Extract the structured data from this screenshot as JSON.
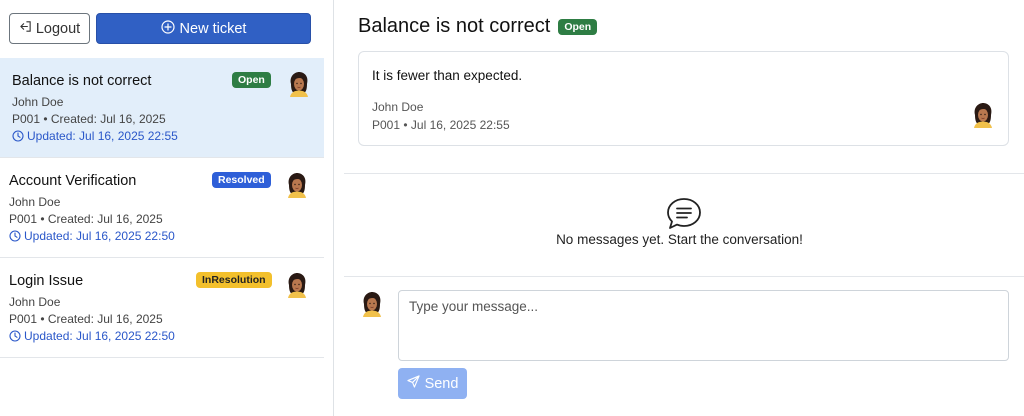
{
  "sidebar": {
    "logout_label": "Logout",
    "new_ticket_label": "New ticket",
    "tickets": [
      {
        "title": "Balance is not correct",
        "status": "Open",
        "name": "John Doe",
        "meta": "P001 • Created: Jul 16, 2025",
        "updated": "Updated: Jul 16, 2025 22:55"
      },
      {
        "title": "Account Verification",
        "status": "Resolved",
        "name": "John Doe",
        "meta": "P001 • Created: Jul 16, 2025",
        "updated": "Updated: Jul 16, 2025 22:50"
      },
      {
        "title": "Login Issue",
        "status": "InResolution",
        "name": "John Doe",
        "meta": "P001 • Created: Jul 16, 2025",
        "updated": "Updated: Jul 16, 2025 22:50"
      }
    ]
  },
  "detail": {
    "title": "Balance is not correct",
    "status": "Open",
    "description": "It is fewer than expected.",
    "author": "John Doe",
    "meta": "P001 • Jul 16, 2025 22:55"
  },
  "messages": {
    "empty_text": "No messages yet. Start the conversation!"
  },
  "composer": {
    "placeholder": "Type your message...",
    "send_label": "Send"
  },
  "colors": {
    "primary": "#3060c4",
    "open": "#2e7d44",
    "resolved": "#2e5fd8",
    "in_resolution": "#f3c02c",
    "active_row": "#e2eefa"
  }
}
